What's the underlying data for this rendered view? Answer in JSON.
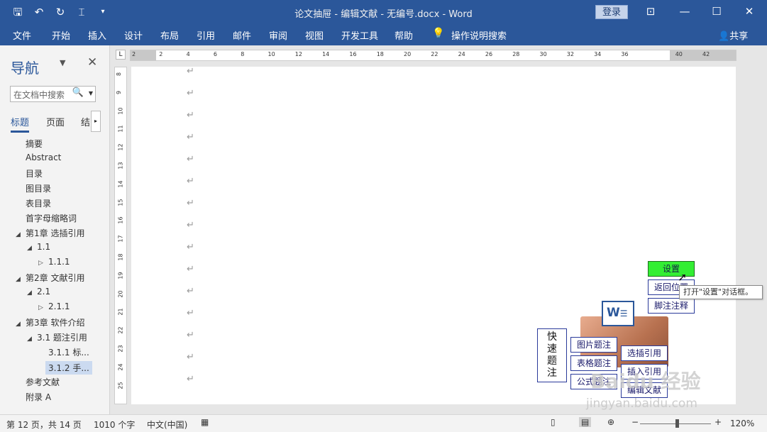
{
  "titlebar": {
    "title": "论文抽屉 - 编辑文献 - 无编号.docx  -  Word",
    "login": "登录",
    "qat_icons": [
      "save-icon",
      "undo-icon",
      "redo-icon",
      "layout-icon",
      "customize-icon"
    ]
  },
  "ribbon": {
    "tabs": [
      "文件",
      "开始",
      "插入",
      "设计",
      "布局",
      "引用",
      "邮件",
      "审阅",
      "视图",
      "开发工具",
      "帮助"
    ],
    "tell_me": "操作说明搜索",
    "share": "共享"
  },
  "nav": {
    "title": "导航",
    "search_placeholder": "在文档中搜索",
    "tabs": [
      "标题",
      "页面",
      "结"
    ],
    "items": [
      {
        "label": "摘要",
        "level": 0,
        "tri": ""
      },
      {
        "label": "Abstract",
        "level": 0,
        "tri": ""
      },
      {
        "label": "目录",
        "level": 0,
        "tri": ""
      },
      {
        "label": "图目录",
        "level": 0,
        "tri": ""
      },
      {
        "label": "表目录",
        "level": 0,
        "tri": ""
      },
      {
        "label": "首字母缩略词",
        "level": 0,
        "tri": ""
      },
      {
        "label": "第1章 选插引用",
        "level": 0,
        "tri": "◢"
      },
      {
        "label": "1.1",
        "level": 1,
        "tri": "◢"
      },
      {
        "label": "1.1.1",
        "level": 2,
        "tri": "▷"
      },
      {
        "label": "第2章 文献引用",
        "level": 0,
        "tri": "◢"
      },
      {
        "label": "2.1",
        "level": 1,
        "tri": "◢"
      },
      {
        "label": "2.1.1",
        "level": 2,
        "tri": "▷"
      },
      {
        "label": "第3章 软件介绍",
        "level": 0,
        "tri": "◢"
      },
      {
        "label": "3.1 题注引用",
        "level": 1,
        "tri": "◢"
      },
      {
        "label": "3.1.1 标...",
        "level": 2,
        "tri": ""
      },
      {
        "label": "3.1.2 手...",
        "level": 2,
        "tri": ""
      },
      {
        "label": "参考文献",
        "level": 0,
        "tri": ""
      },
      {
        "label": "附录 A",
        "level": 0,
        "tri": ""
      }
    ]
  },
  "ruler": {
    "hnums": [
      "2",
      "2",
      "4",
      "6",
      "8",
      "10",
      "12",
      "14",
      "16",
      "18",
      "20",
      "22",
      "24",
      "26",
      "28",
      "30",
      "32",
      "34",
      "36",
      "40",
      "42"
    ],
    "vnums": [
      "8",
      "9",
      "10",
      "11",
      "12",
      "13",
      "14",
      "15",
      "16",
      "17",
      "18",
      "19",
      "20",
      "21",
      "22",
      "23",
      "24",
      "25"
    ]
  },
  "document": {
    "para_mark": "↵"
  },
  "overlay": {
    "vertical_title": "快速题注",
    "buttons_left": [
      "图片题注",
      "表格题注",
      "公式题注"
    ],
    "buttons_mid": [
      "选插引用",
      "插入引用",
      "编辑文献"
    ],
    "buttons_right": [
      "设置",
      "返回位置",
      "脚注注释"
    ],
    "tooltip": "打开\"设置\"对话框。",
    "word_icon": "W",
    "watermark": "Baidu 经验",
    "watermark_url": "jingyan.baidu.com"
  },
  "status": {
    "page": "第 12 页，共 14 页",
    "words": "1010 个字",
    "lang": "中文(中国)",
    "zoom": "120%",
    "zoom_minus": "−",
    "zoom_plus": "+"
  }
}
